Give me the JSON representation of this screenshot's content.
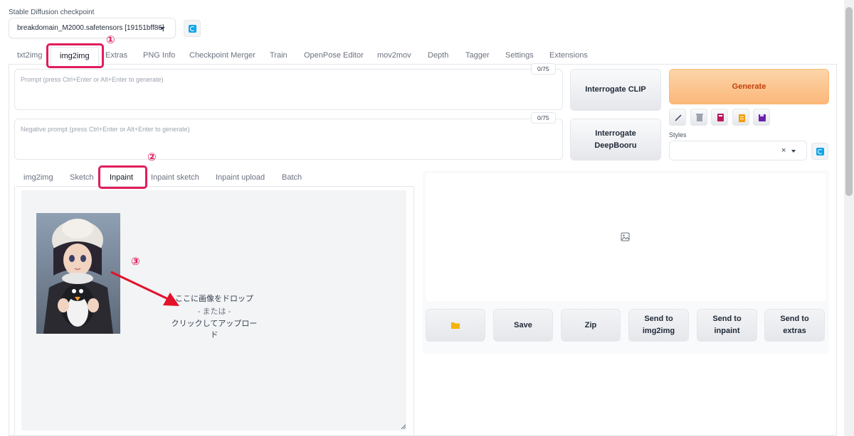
{
  "checkpoint": {
    "label": "Stable Diffusion checkpoint",
    "value": "breakdomain_M2000.safetensors [19151bff86]"
  },
  "top_tabs": [
    "txt2img",
    "img2img",
    "Extras",
    "PNG Info",
    "Checkpoint Merger",
    "Train",
    "OpenPose Editor",
    "mov2mov",
    "Depth",
    "Tagger",
    "Settings",
    "Extensions"
  ],
  "active_top_tab": "img2img",
  "prompt": {
    "placeholder": "Prompt (press Ctrl+Enter or Alt+Enter to generate)",
    "counter": "0/75"
  },
  "negative_prompt": {
    "placeholder": "Negative prompt (press Ctrl+Enter or Alt+Enter to generate)",
    "counter": "0/75"
  },
  "buttons": {
    "interrogate_clip": "Interrogate CLIP",
    "interrogate_deepbooru_1": "Interrogate",
    "interrogate_deepbooru_2": "DeepBooru",
    "generate": "Generate"
  },
  "styles": {
    "label": "Styles",
    "clear": "×"
  },
  "sub_tabs": [
    "img2img",
    "Sketch",
    "Inpaint",
    "Inpaint sketch",
    "Inpaint upload",
    "Batch"
  ],
  "active_sub_tab": "Inpaint",
  "drop_zone": {
    "line1": "ここに画像をドロップ",
    "line2": "- または -",
    "line3": "クリックしてアップロード"
  },
  "output_buttons": {
    "save": "Save",
    "zip": "Zip",
    "send_img2img_1": "Send to",
    "send_img2img_2": "img2img",
    "send_inpaint_1": "Send to",
    "send_inpaint_2": "inpaint",
    "send_extras_1": "Send to",
    "send_extras_2": "extras"
  },
  "annotations": [
    "①",
    "②",
    "③"
  ],
  "colors": {
    "accent_highlight": "#e11d5b",
    "generate_bg": "#fbb77a",
    "generate_text": "#c2410c",
    "refresh_icon": "#0ea5e9"
  }
}
